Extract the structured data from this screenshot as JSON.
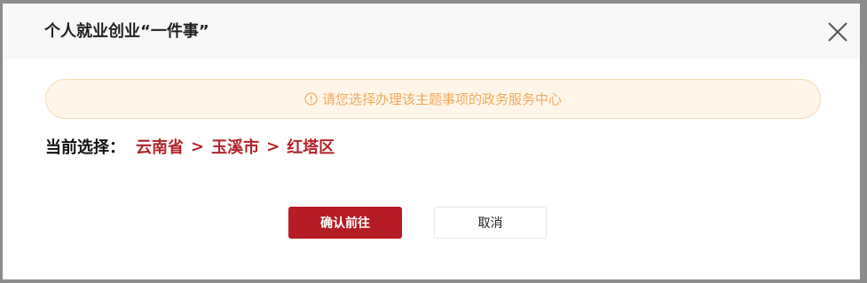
{
  "dialog": {
    "title": "个人就业创业“一件事”",
    "close_icon": "close-icon"
  },
  "notice": {
    "icon": "info-circle-icon",
    "text": "请您选择办理该主题事项的政务服务中心"
  },
  "selection": {
    "label": "当前选择：",
    "province": "云南省",
    "separator": ">",
    "city": "玉溪市",
    "district": "红塔区"
  },
  "actions": {
    "confirm_label": "确认前往",
    "cancel_label": "取消"
  },
  "colors": {
    "primary": "#b51c24",
    "path_text": "#b3232a",
    "notice_text": "#f2a95b",
    "notice_background": "#fff6e9"
  }
}
